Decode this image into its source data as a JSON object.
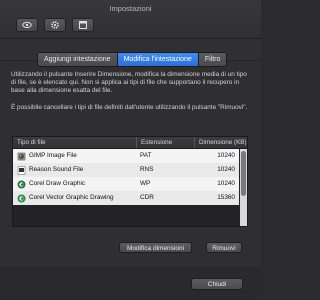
{
  "window": {
    "title": "Impostazioni"
  },
  "toolbar": {
    "icons": [
      "eye-icon",
      "gear-icon",
      "window-icon"
    ]
  },
  "tabs": [
    {
      "label": "Aggiungi intestazione",
      "active": false
    },
    {
      "label": "Modifica l'intestazione",
      "active": true
    },
    {
      "label": "Filtro",
      "active": false
    }
  ],
  "description": {
    "p1": "Utilizzando il pulsante Inserire Dimensione, modifica la dimensione media di un tipo di file, se è elencato qui. Non si applica ai tipi di file che supportano il recupero in base alla dimensione esatta del file.",
    "p2": "È possibile cancellare i tipi di file definiti dall'utente utilizzando il pulsante \"Rimuovi\"."
  },
  "table": {
    "headers": [
      "Tipo di file",
      "Estensione",
      "Dimensione (KB)"
    ],
    "rows": [
      {
        "name": "GIMP Image File",
        "ext": "PAT",
        "size": "10240",
        "icon": "gimp-file-icon"
      },
      {
        "name": "Reason Sound File",
        "ext": "RNS",
        "size": "10240",
        "icon": "reason-file-icon"
      },
      {
        "name": "Corel Draw Graphic",
        "ext": "WP",
        "size": "10240",
        "icon": "corel-draw-icon"
      },
      {
        "name": "Corel Vector Graphic Drawing",
        "ext": "CDR",
        "size": "15360",
        "icon": "corel-vector-icon"
      }
    ]
  },
  "buttons": {
    "modify": "Modifica dimensioni",
    "remove": "Rimuovi",
    "close": "Chiudi"
  },
  "colors": {
    "accent": "#2f78e4"
  }
}
